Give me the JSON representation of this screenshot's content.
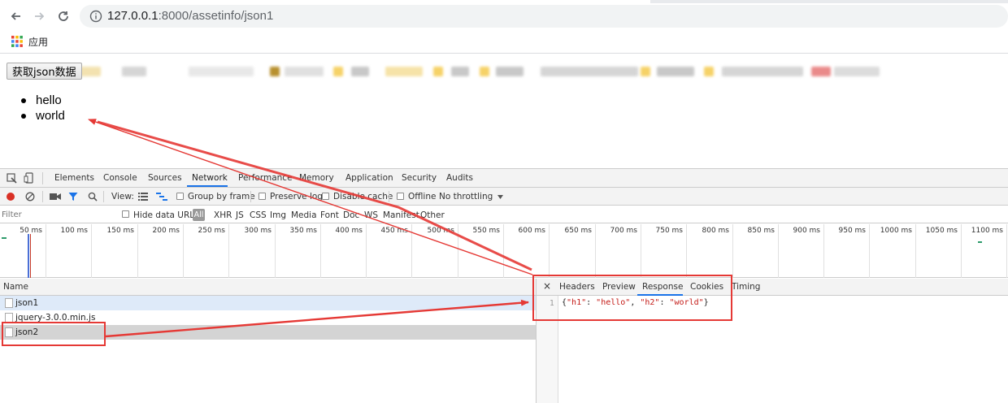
{
  "browser": {
    "url_host": "127.0.0.1",
    "url_rest": ":8000/assetinfo/json1",
    "bookmarks_apps_label": "应用"
  },
  "page": {
    "fetch_button_label": "获取json数据",
    "results": [
      "hello",
      "world"
    ]
  },
  "devtools": {
    "tabs": [
      "Elements",
      "Console",
      "Sources",
      "Network",
      "Performance",
      "Memory",
      "Application",
      "Security",
      "Audits"
    ],
    "active_tab": "Network",
    "toolbar": {
      "view_label": "View:",
      "group_by_frame": "Group by frame",
      "preserve_log": "Preserve log",
      "disable_cache": "Disable cache",
      "offline": "Offline",
      "throttling": "No throttling"
    },
    "filter": {
      "placeholder": "Filter",
      "hide_data_urls": "Hide data URLs",
      "types": [
        "All",
        "XHR",
        "JS",
        "CSS",
        "Img",
        "Media",
        "Font",
        "Doc",
        "WS",
        "Manifest",
        "Other"
      ]
    },
    "timeline_ticks": [
      "50 ms",
      "100 ms",
      "150 ms",
      "200 ms",
      "250 ms",
      "300 ms",
      "350 ms",
      "400 ms",
      "450 ms",
      "500 ms",
      "550 ms",
      "600 ms",
      "650 ms",
      "700 ms",
      "750 ms",
      "800 ms",
      "850 ms",
      "900 ms",
      "950 ms",
      "1000 ms",
      "1050 ms",
      "1100 ms"
    ],
    "name_header": "Name",
    "requests": [
      "json1",
      "jquery-3.0.0.min.js",
      "json2"
    ],
    "detail_tabs": [
      "Headers",
      "Preview",
      "Response",
      "Cookies",
      "Timing"
    ],
    "active_detail_tab": "Response",
    "close_glyph": "×",
    "response_line_number": "1",
    "response_body": {
      "open": "{",
      "k1": "\"h1\"",
      "sep1": ": ",
      "v1": "\"hello\"",
      "comma": ", ",
      "k2": "\"h2\"",
      "sep2": ": ",
      "v2": "\"world\"",
      "close": "}"
    }
  },
  "colors": {
    "accent": "#1a73e8",
    "annotation": "#e53935",
    "record": "#d93025"
  }
}
